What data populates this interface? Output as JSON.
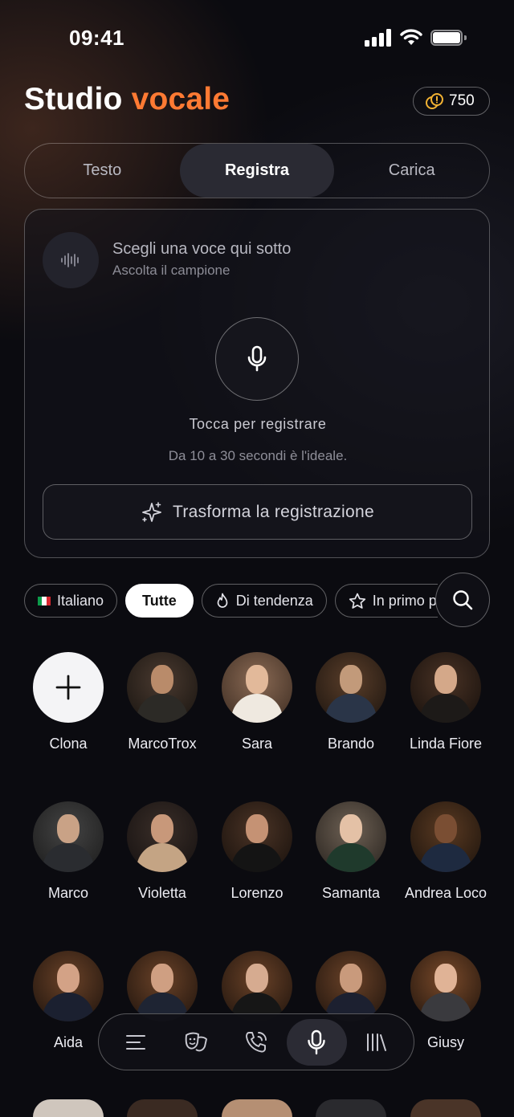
{
  "status_bar": {
    "time": "09:41"
  },
  "header": {
    "title_main": "Studio",
    "title_accent": "vocale",
    "credits": "750"
  },
  "tabs": [
    {
      "label": "Testo",
      "active": false
    },
    {
      "label": "Registra",
      "active": true
    },
    {
      "label": "Carica",
      "active": false
    }
  ],
  "recorder": {
    "choose_title": "Scegli una voce qui sotto",
    "choose_subtitle": "Ascolta il campione",
    "tap_label": "Tocca per registrare",
    "hint": "Da 10 a 30 secondi è l'ideale.",
    "transform_label": "Trasforma la registrazione"
  },
  "filters": [
    {
      "label": "Italiano",
      "icon": "italian-flag-icon",
      "active": false
    },
    {
      "label": "Tutte",
      "icon": "",
      "active": true
    },
    {
      "label": "Di tendenza",
      "icon": "flame-icon",
      "active": false
    },
    {
      "label": "In primo piano",
      "icon": "star-icon",
      "active": false
    }
  ],
  "voices": [
    {
      "name": "Clona",
      "type": "add"
    },
    {
      "name": "MarcoTrox"
    },
    {
      "name": "Sara"
    },
    {
      "name": "Brando"
    },
    {
      "name": "Linda Fiore"
    },
    {
      "name": "Marco"
    },
    {
      "name": "Violetta"
    },
    {
      "name": "Lorenzo"
    },
    {
      "name": "Samanta"
    },
    {
      "name": "Andrea Loco"
    },
    {
      "name": "Aida"
    },
    {
      "name": ""
    },
    {
      "name": ""
    },
    {
      "name": ""
    },
    {
      "name": "Giusy"
    }
  ],
  "bottom_nav": [
    {
      "icon": "menu-lines-icon",
      "active": false
    },
    {
      "icon": "theater-masks-icon",
      "active": false
    },
    {
      "icon": "phone-call-icon",
      "active": false
    },
    {
      "icon": "microphone-icon",
      "active": true
    },
    {
      "icon": "library-icon",
      "active": false
    }
  ],
  "colors": {
    "accent": "#ff7a33",
    "background": "#0b0b10",
    "active_tab": "#2a2a33"
  }
}
